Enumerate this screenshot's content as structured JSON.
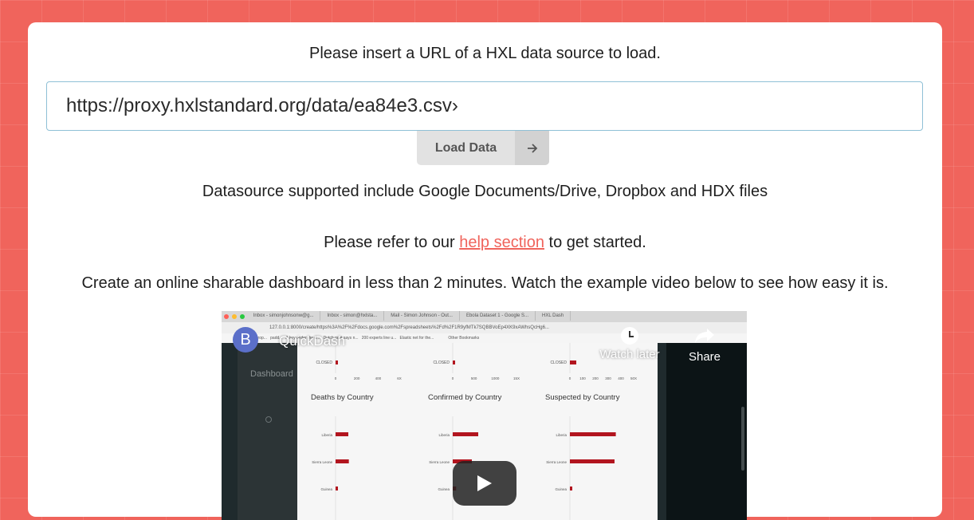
{
  "intro_text": "Please insert a URL of a HXL data source to load.",
  "url_input": {
    "value": "https://proxy.hxlstandard.org/data/ea84e3.csv›"
  },
  "load_button": {
    "label": "Load Data",
    "icon": "arrow-right-icon"
  },
  "datasource_text": "Datasource supported include Google Documents/Drive, Dropbox and HDX files",
  "help": {
    "before": "Please refer to our ",
    "link": "help section",
    "after": " to get started."
  },
  "promo_text": "Create an online sharable dashboard in less than 2 minutes. Watch the example video below to see how easy it is.",
  "video": {
    "avatar_letter": "B",
    "title": "QuickDash",
    "watch_later": "Watch later",
    "share": "Share",
    "browser_tabs": [
      "Inbox - simonjohnsonw@g...",
      "Inbox - simon@hxlsta...",
      "Mail - Simon Johnson - Out...",
      "Ebola Dataset 1 - Google S...",
      "HXL Dash"
    ],
    "address_bar": "127.0.0.1:8000/create/https%3A%2F%2Fdocs.google.com%2Fspreadsheets%2Fd%2F1R9yfMTk7SQBBVoEp4XK9xAWhsQcHg6...",
    "bookmarks": [
      "europ...",
      "padd...",
      "A key under the d...",
      "Dutch govt says n...",
      "200 experts line u...",
      "Elastic net for the...",
      "Other Bookmarks"
    ],
    "dashboard_label": "Dashboard",
    "charts": [
      {
        "title": "Deaths by Country",
        "ticks": [
          "0",
          "200",
          "400",
          "6X"
        ],
        "bar_label": "CLOSED",
        "countries": [
          "Liberia",
          "Sierra Leone",
          "Guinea"
        ],
        "top_value": 5,
        "values": [
          120,
          125,
          22
        ],
        "max": 600
      },
      {
        "title": "Confirmed by Country",
        "ticks": [
          "0",
          "500",
          "1000",
          "15X"
        ],
        "bar_label": "CLOSED",
        "countries": [
          "Liberia",
          "Sierra Leone",
          "Guinea"
        ],
        "top_value": 40,
        "values": [
          600,
          450,
          80
        ],
        "max": 1500
      },
      {
        "title": "Suspected by Country",
        "ticks": [
          "0",
          "100",
          "200",
          "300",
          "400",
          "50X"
        ],
        "bar_label": "CLOSED",
        "countries": [
          "Liberia",
          "Sierra Leone",
          "Guinea"
        ],
        "top_value": 50,
        "values": [
          360,
          350,
          10
        ],
        "max": 500
      }
    ]
  },
  "colors": {
    "background": "#f0645c",
    "link": "#f0645c",
    "bar": "#b2151f"
  }
}
